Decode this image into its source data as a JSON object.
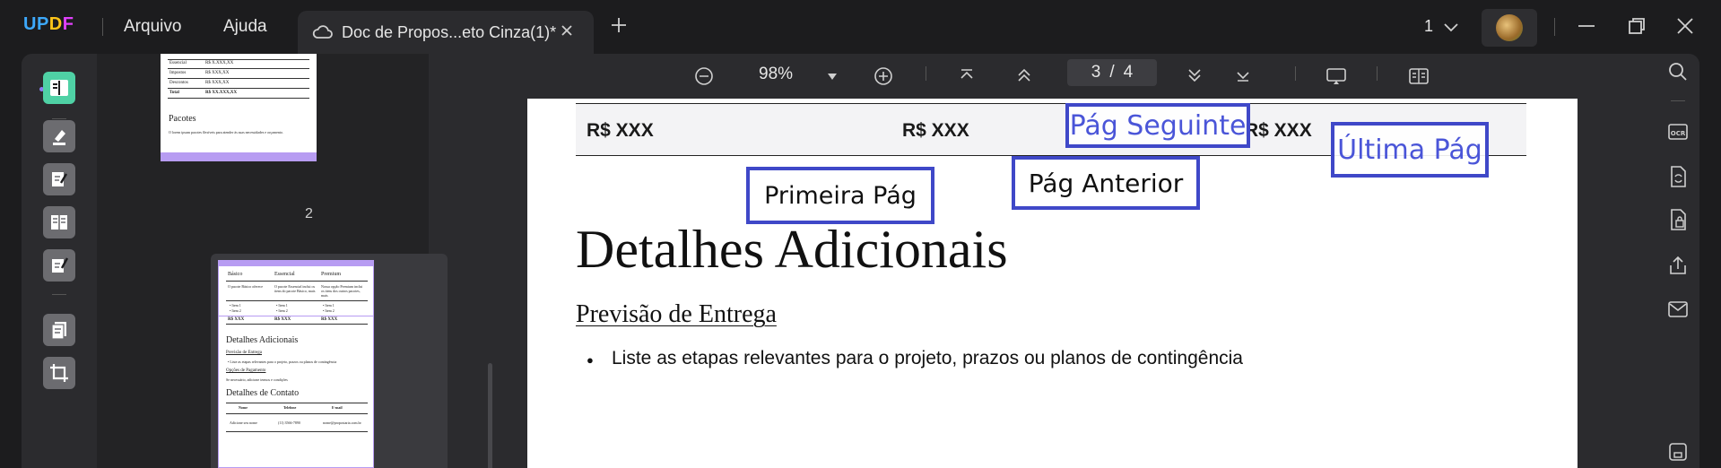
{
  "app": {
    "logo": "UPDF",
    "menu": [
      "Arquivo",
      "Ajuda"
    ],
    "tab_title": "Doc de Propos...eto Cinza(1)*",
    "page_selector": "1"
  },
  "toolbar": {
    "zoom": "98%",
    "current_page": "3",
    "page_sep": "/",
    "total_pages": "4"
  },
  "thumbnails": [
    {
      "page_number": "2",
      "rows": [
        {
          "label": "Essencial",
          "value": "R$ X.XXX,XX"
        },
        {
          "label": "Impostos",
          "value": "R$ XXX,XX"
        },
        {
          "label": "Descontos",
          "value": "R$ XXX,XX"
        },
        {
          "label": "Total",
          "value": "R$ XX.XXX,XX"
        }
      ],
      "section_title": "Pacotes",
      "section_text": "O lorem ipsum pacotes flexíveis para atender às suas necessidades e orçamento."
    },
    {
      "cols": [
        "Básico",
        "Essencial",
        "Premium"
      ],
      "descs": [
        "O pacote Básico oferece",
        "O pacote Essencial inclui os itens do pacote Básico, mais",
        "Nossa opção Premium inclui os itens dos outros pacotes, mais"
      ],
      "items": [
        "• Item 1",
        "• Item 2"
      ],
      "prices": [
        "R$ XXX",
        "R$ XXX",
        "R$ XXX"
      ],
      "heading1": "Detalhes Adicionais",
      "sub1": "Previsão de Entrega",
      "sub1_text": "• Liste as etapas relevantes para o projeto, prazos ou planos de contingência",
      "sub2": "Opções de Pagamento",
      "sub2_text": "Se necessário, adicione termos e condições",
      "heading2": "Detalhes de Contato",
      "contact_cols": [
        "Nome",
        "Telefone",
        "E-mail"
      ],
      "contact_vals": [
        "Adicione seu nome",
        "(11) 3566-7890",
        "nome@propostaria.com.br"
      ]
    }
  ],
  "page": {
    "prices": [
      "R$ XXX",
      "R$ XXX",
      "R$ XXX"
    ],
    "nav": {
      "next": "Pág Seguinte",
      "last": "Última Pág",
      "first": "Primeira Pág",
      "prev": "Pág Anterior"
    },
    "heading": "Detalhes Adicionais",
    "subheading": "Previsão de Entrega",
    "bullet": "Liste as etapas relevantes para o projeto, prazos ou planos de contingência"
  },
  "colors": {
    "accent_green": "#4fd1a5",
    "nav_box_border": "#3f48c8",
    "nav_link_text": "#4a55d8",
    "thumb_band": "#b79cf2"
  }
}
